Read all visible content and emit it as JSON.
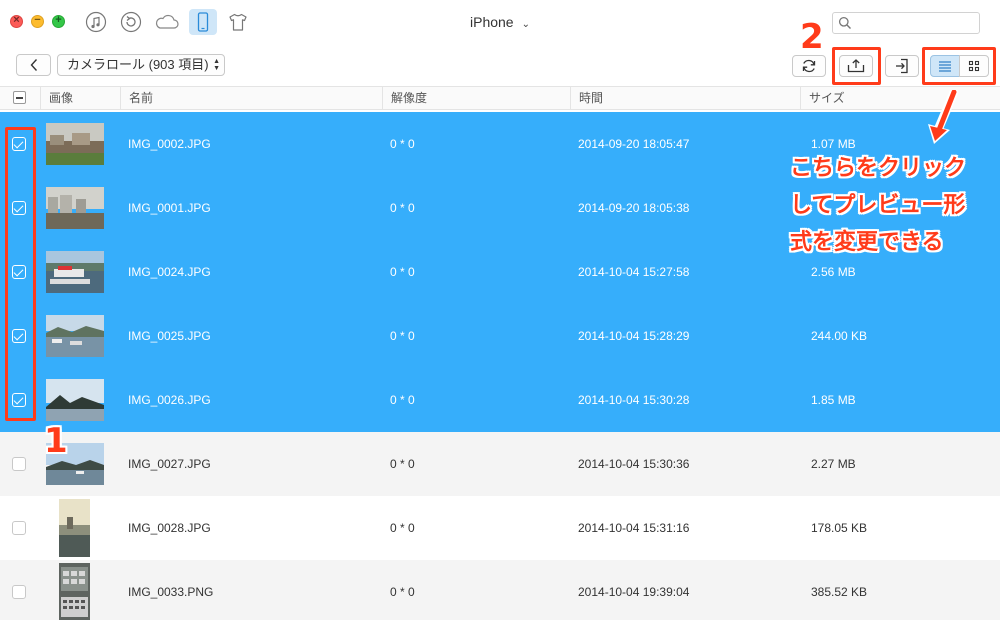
{
  "window": {
    "device_name": "iPhone",
    "traffic": [
      "close",
      "minimize",
      "zoom"
    ]
  },
  "top_icons": [
    {
      "name": "music-icon",
      "active": false
    },
    {
      "name": "backup-icon",
      "active": false
    },
    {
      "name": "icloud-icon",
      "active": false
    },
    {
      "name": "device-icon",
      "active": true
    },
    {
      "name": "shirt-icon",
      "active": false
    }
  ],
  "search": {
    "placeholder": "",
    "value": ""
  },
  "toolbar": {
    "album_label": "カメラロール (903 項目)",
    "annotation_step2": "2",
    "annotation_step1": "1"
  },
  "columns": {
    "image": "画像",
    "name": "名前",
    "resolution": "解像度",
    "time": "時間",
    "size": "サイズ"
  },
  "rows": [
    {
      "name": "IMG_0002.JPG",
      "resolution": "0 * 0",
      "time": "2014-09-20 18:05:47",
      "size": "1.07 MB",
      "selected": true
    },
    {
      "name": "IMG_0001.JPG",
      "resolution": "0 * 0",
      "time": "2014-09-20 18:05:38",
      "size": "",
      "selected": true
    },
    {
      "name": "IMG_0024.JPG",
      "resolution": "0 * 0",
      "time": "2014-10-04 15:27:58",
      "size": "2.56 MB",
      "selected": true
    },
    {
      "name": "IMG_0025.JPG",
      "resolution": "0 * 0",
      "time": "2014-10-04 15:28:29",
      "size": "244.00 KB",
      "selected": true
    },
    {
      "name": "IMG_0026.JPG",
      "resolution": "0 * 0",
      "time": "2014-10-04 15:30:28",
      "size": "1.85 MB",
      "selected": true
    },
    {
      "name": "IMG_0027.JPG",
      "resolution": "0 * 0",
      "time": "2014-10-04 15:30:36",
      "size": "2.27 MB",
      "selected": false
    },
    {
      "name": "IMG_0028.JPG",
      "resolution": "0 * 0",
      "time": "2014-10-04 15:31:16",
      "size": "178.05 KB",
      "selected": false
    },
    {
      "name": "IMG_0033.PNG",
      "resolution": "0 * 0",
      "time": "2014-10-04 19:39:04",
      "size": "385.52 KB",
      "selected": false
    }
  ],
  "callout": {
    "line1": "こちらをクリック",
    "line2": "してプレビュー形",
    "line3": "式を変更できる"
  },
  "colors": {
    "selection": "#36aefb",
    "annotation": "#ff3b1a",
    "active_tab": "#cfe6f8"
  }
}
